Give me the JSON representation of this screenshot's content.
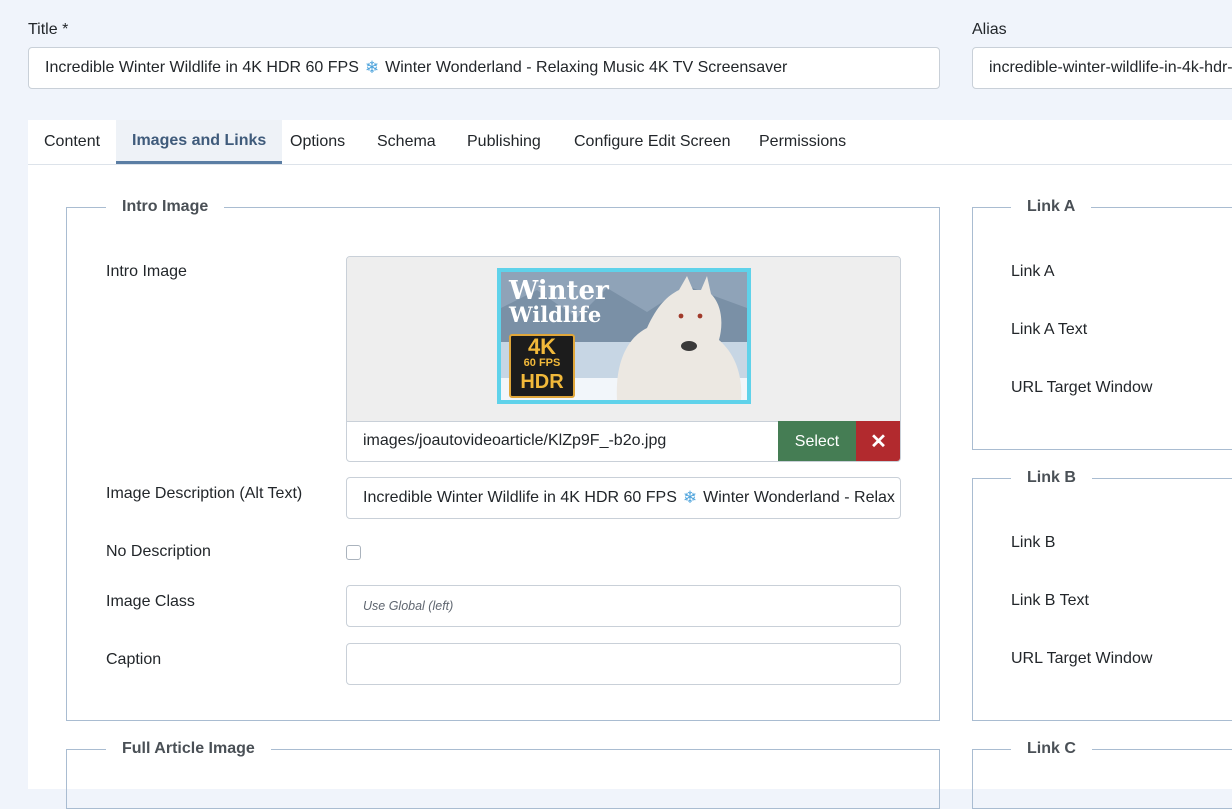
{
  "header": {
    "title_label": "Title *",
    "title_value_a": "Incredible Winter Wildlife in 4K HDR 60 FPS",
    "title_value_b": "Winter Wonderland - Relaxing Music 4K TV Screensaver",
    "alias_label": "Alias",
    "alias_value": "incredible-winter-wildlife-in-4k-hdr-"
  },
  "tabs": [
    {
      "label": "Content"
    },
    {
      "label": "Images and Links",
      "active": true
    },
    {
      "label": "Options"
    },
    {
      "label": "Schema"
    },
    {
      "label": "Publishing"
    },
    {
      "label": "Configure Edit Screen"
    },
    {
      "label": "Permissions"
    }
  ],
  "intro": {
    "legend": "Intro Image",
    "image_label": "Intro Image",
    "image_path": "images/joautovideoarticle/KlZp9F_-b2o.jpg",
    "select_label": "Select",
    "clear_label": "✕",
    "thumb_text": {
      "line1": "Winter",
      "line2": "Wildlife",
      "badge_4k": "4K",
      "badge_fps": "60 FPS",
      "badge_hdr": "HDR"
    },
    "alt_label": "Image Description (Alt Text)",
    "alt_value_a": "Incredible Winter Wildlife in 4K HDR 60 FPS",
    "alt_value_b": "Winter Wonderland - Relax",
    "nodesc_label": "No Description",
    "nodesc_checked": false,
    "class_label": "Image Class",
    "class_placeholder": "Use Global (left)",
    "caption_label": "Caption",
    "caption_value": ""
  },
  "full_article": {
    "legend": "Full Article Image"
  },
  "link_a": {
    "legend": "Link A",
    "link_label": "Link A",
    "text_label": "Link A Text",
    "target_label": "URL Target Window"
  },
  "link_b": {
    "legend": "Link B",
    "link_label": "Link B",
    "text_label": "Link B Text",
    "target_label": "URL Target Window"
  },
  "link_c": {
    "legend": "Link C"
  },
  "icons": {
    "snowflake": "❄"
  },
  "colors": {
    "accent": "#3f5b7b",
    "select_btn": "#457d54",
    "clear_btn": "#b22a2e",
    "background": "#f0f4fb"
  }
}
